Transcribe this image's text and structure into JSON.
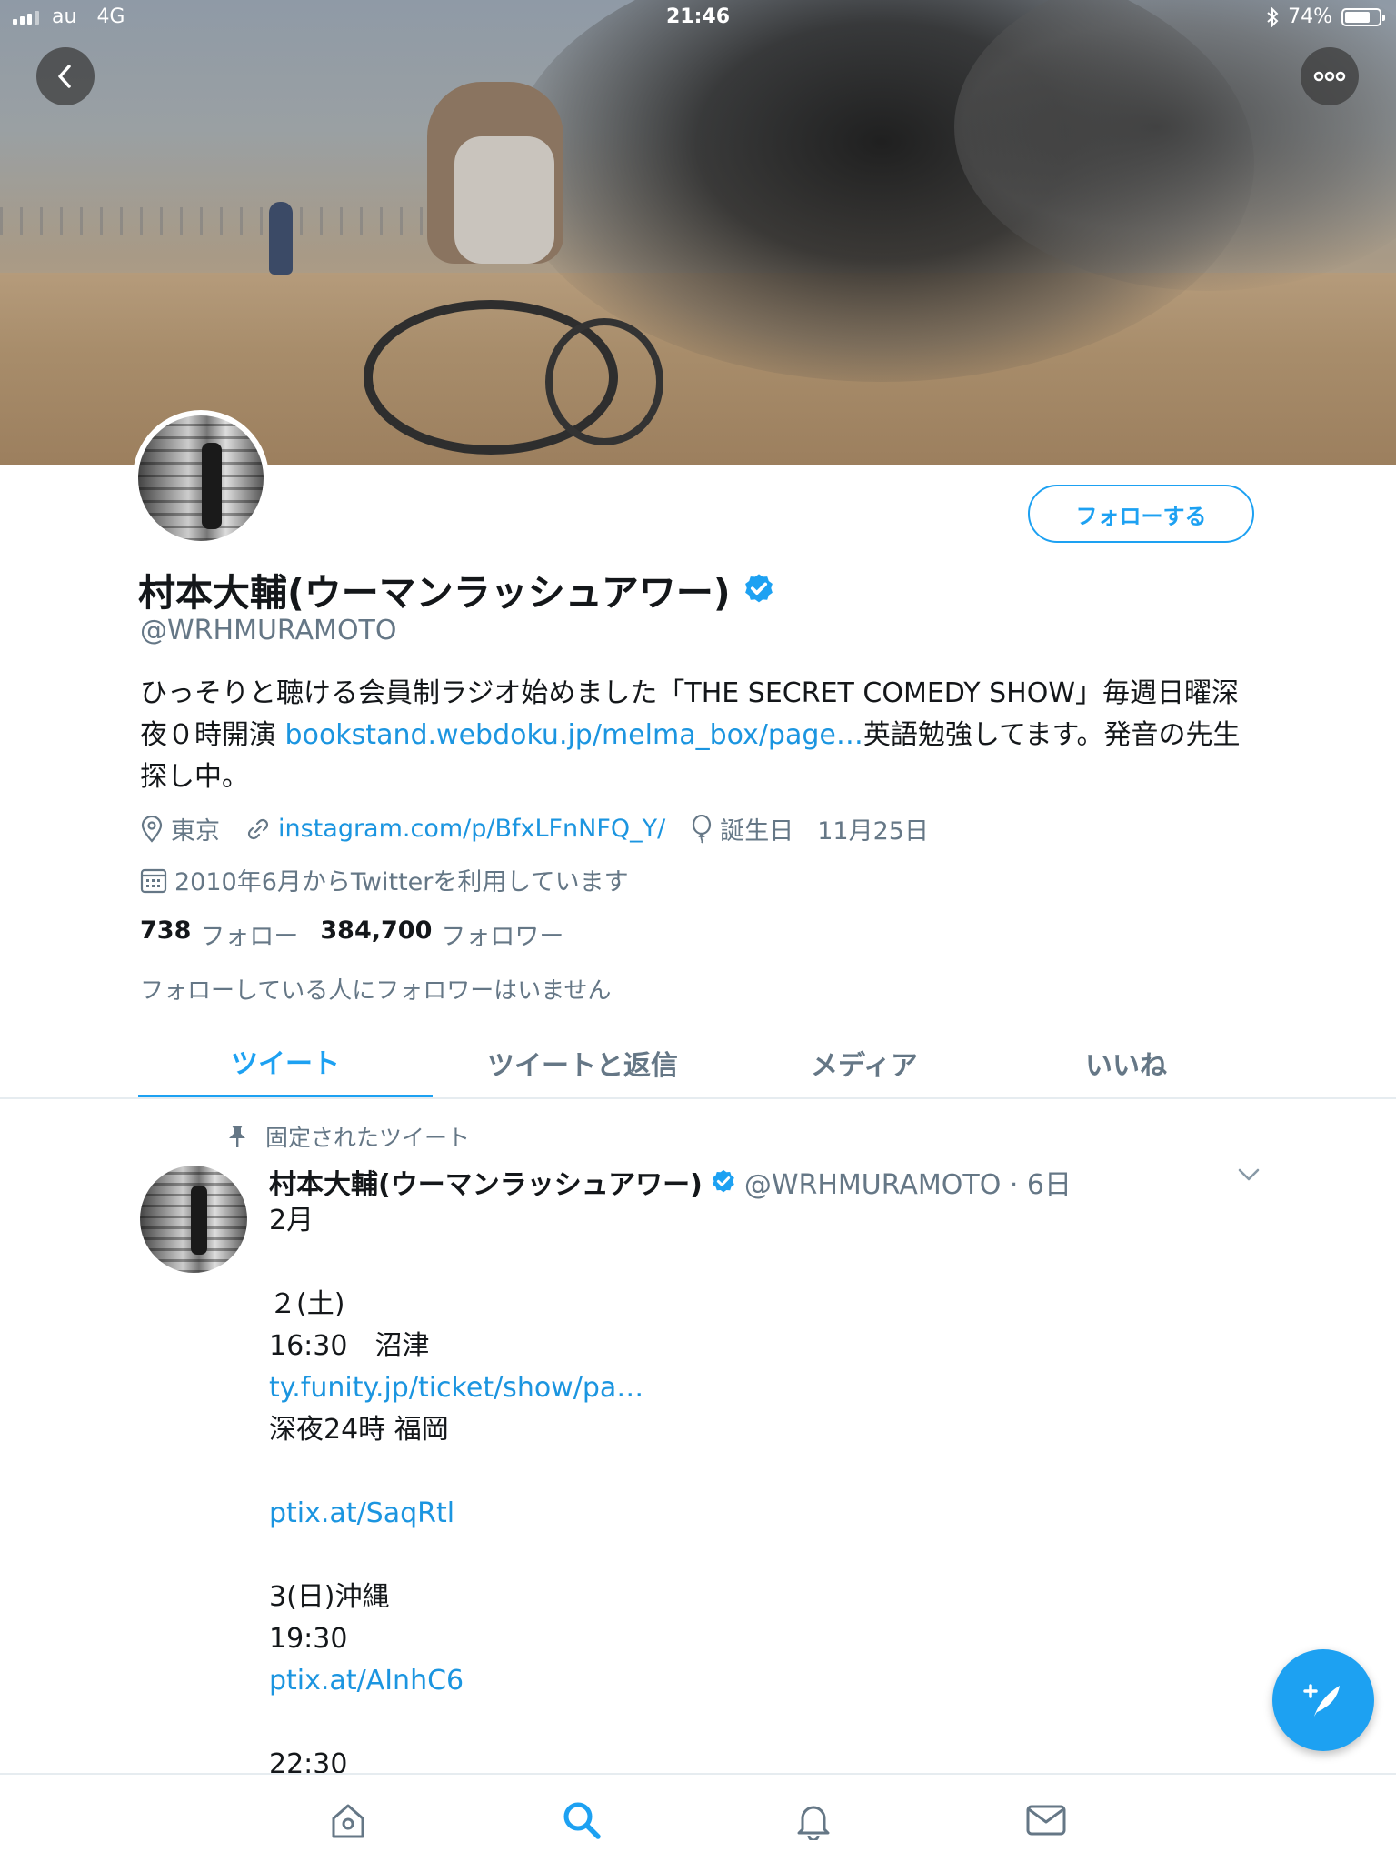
{
  "status_bar": {
    "carrier": "au",
    "network": "4G",
    "time": "21:46",
    "battery": "74%",
    "battery_level": 0.74
  },
  "header": {
    "follow_button": "フォローする"
  },
  "profile": {
    "display_name": "村本大輔(ウーマンラッシュアワー)",
    "handle": "@WRHMURAMOTO",
    "bio_part1": "ひっそりと聴ける会員制ラジオ始めました「THE SECRET COMEDY SHOW」毎週日曜深夜０時開演 ",
    "bio_link": "bookstand.webdoku.jp/melma_box/page…",
    "bio_part2": "英語勉強してます。発音の先生探し中。",
    "location": "東京",
    "website": "instagram.com/p/BfxLFnNFQ_Y/",
    "birthday_label": "誕生日",
    "birthday": "11月25日",
    "joined": "2010年6月からTwitterを利用しています",
    "following_count": "738",
    "following_label": "フォロー",
    "followers_count": "384,700",
    "followers_label": "フォロワー",
    "followed_by": "フォローしている人にフォロワーはいません"
  },
  "tabs": [
    {
      "label": "ツイート",
      "active": true
    },
    {
      "label": "ツイートと返信",
      "active": false
    },
    {
      "label": "メディア",
      "active": false
    },
    {
      "label": "いいね",
      "active": false
    }
  ],
  "pinned_tweet": {
    "pinned_label": "固定されたツイート",
    "name": "村本大輔(ウーマンラッシュアワー)",
    "meta": "@WRHMURAMOTO · 6日",
    "lines": [
      {
        "text": "2月",
        "link": false
      },
      {
        "text": "",
        "link": false
      },
      {
        "text": "２(土)",
        "link": false
      },
      {
        "text": "16:30　沼津",
        "link": false
      },
      {
        "text": "ty.funity.jp/ticket/show/pa…",
        "link": true
      },
      {
        "text": "深夜24時 福岡",
        "link": false
      },
      {
        "text": "",
        "link": false
      },
      {
        "text": "ptix.at/SaqRtl",
        "link": true
      },
      {
        "text": "",
        "link": false
      },
      {
        "text": "3(日)沖縄",
        "link": false
      },
      {
        "text": "19:30",
        "link": false
      },
      {
        "text": "ptix.at/AInhC6",
        "link": true
      },
      {
        "text": "",
        "link": false
      },
      {
        "text": "22:30",
        "link": false
      }
    ]
  },
  "colors": {
    "accent": "#1da1f2",
    "link": "#1b95e0",
    "secondary_text": "#657786",
    "divider": "#e6ecf0"
  },
  "icons": {
    "back": "chevron-left-icon",
    "more": "more-dots-icon",
    "location": "location-pin-icon",
    "link": "link-icon",
    "birthday": "balloon-icon",
    "calendar": "calendar-icon",
    "pin": "pin-icon",
    "verified": "verified-badge-icon",
    "caret": "chevron-down-icon",
    "compose": "compose-tweet-icon",
    "nav": [
      "home-icon",
      "search-icon",
      "notifications-icon",
      "messages-icon"
    ]
  }
}
